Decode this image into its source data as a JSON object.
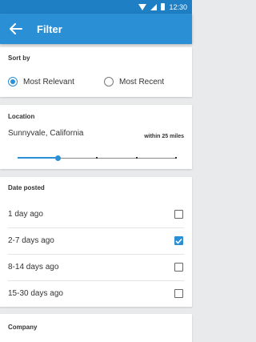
{
  "status_bar": {
    "time": "12:30"
  },
  "app_bar": {
    "title": "Filter"
  },
  "sort_by": {
    "label": "Sort by",
    "options": [
      {
        "label": "Most Relevant",
        "selected": true
      },
      {
        "label": "Most Recent",
        "selected": false
      }
    ]
  },
  "location": {
    "label": "Location",
    "value": "Sunnyvale, California",
    "range_label": "within 25 miles",
    "slider": {
      "stops": 5,
      "selected_stop": 1
    }
  },
  "date_posted": {
    "label": "Date posted",
    "options": [
      {
        "label": "1 day ago",
        "checked": false
      },
      {
        "label": "2-7 days ago",
        "checked": true
      },
      {
        "label": "8-14 days ago",
        "checked": false
      },
      {
        "label": "15-30 days ago",
        "checked": false
      }
    ]
  },
  "company": {
    "label": "Company"
  },
  "colors": {
    "accent": "#2b8fd6",
    "status_bar": "#1e7fc4"
  }
}
